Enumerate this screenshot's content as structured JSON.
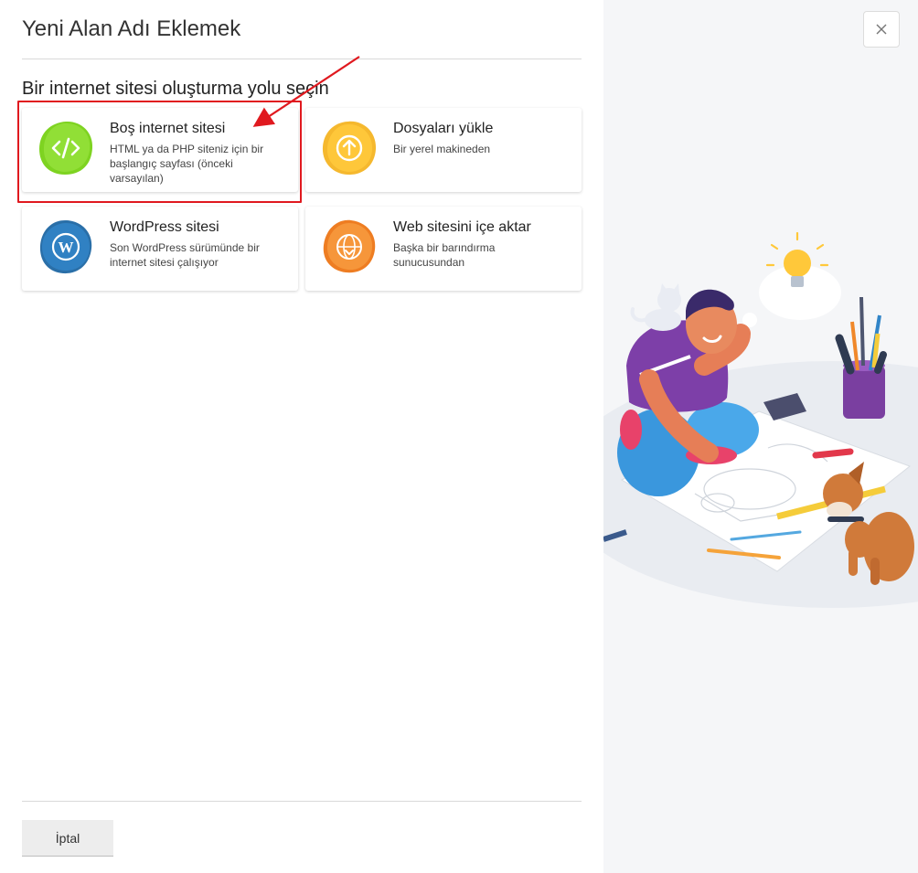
{
  "dialog": {
    "title": "Yeni Alan Adı Eklemek",
    "section_title": "Bir internet sitesi oluşturma yolu seçin",
    "cancel_label": "İptal"
  },
  "options": [
    {
      "title": "Boş internet sitesi",
      "description": "HTML ya da PHP siteniz için bir başlangıç sayfası (önceki varsayılan)",
      "icon": "code-icon",
      "color": "#7ed321"
    },
    {
      "title": "Dosyaları yükle",
      "description": "Bir yerel makineden",
      "icon": "upload-icon",
      "color": "#f5b82e"
    },
    {
      "title": "WordPress sitesi",
      "description": "Son WordPress sürümünde bir internet sitesi çalışıyor",
      "icon": "wordpress-icon",
      "color": "#2f7fc1"
    },
    {
      "title": "Web sitesini içe aktar",
      "description": "Başka bir barındırma sunucusundan",
      "icon": "globe-import-icon",
      "color": "#f0882a"
    }
  ],
  "colors": {
    "highlight": "#e0191f",
    "panel_bg": "#f5f6f8"
  }
}
